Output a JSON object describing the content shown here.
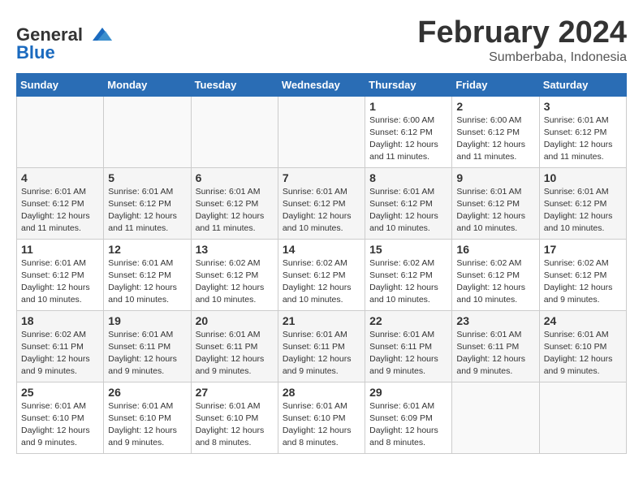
{
  "logo": {
    "general": "General",
    "blue": "Blue"
  },
  "title": "February 2024",
  "subtitle": "Sumberbaba, Indonesia",
  "headers": [
    "Sunday",
    "Monday",
    "Tuesday",
    "Wednesday",
    "Thursday",
    "Friday",
    "Saturday"
  ],
  "weeks": [
    [
      {
        "day": "",
        "info": ""
      },
      {
        "day": "",
        "info": ""
      },
      {
        "day": "",
        "info": ""
      },
      {
        "day": "",
        "info": ""
      },
      {
        "day": "1",
        "info": "Sunrise: 6:00 AM\nSunset: 6:12 PM\nDaylight: 12 hours\nand 11 minutes."
      },
      {
        "day": "2",
        "info": "Sunrise: 6:00 AM\nSunset: 6:12 PM\nDaylight: 12 hours\nand 11 minutes."
      },
      {
        "day": "3",
        "info": "Sunrise: 6:01 AM\nSunset: 6:12 PM\nDaylight: 12 hours\nand 11 minutes."
      }
    ],
    [
      {
        "day": "4",
        "info": "Sunrise: 6:01 AM\nSunset: 6:12 PM\nDaylight: 12 hours\nand 11 minutes."
      },
      {
        "day": "5",
        "info": "Sunrise: 6:01 AM\nSunset: 6:12 PM\nDaylight: 12 hours\nand 11 minutes."
      },
      {
        "day": "6",
        "info": "Sunrise: 6:01 AM\nSunset: 6:12 PM\nDaylight: 12 hours\nand 11 minutes."
      },
      {
        "day": "7",
        "info": "Sunrise: 6:01 AM\nSunset: 6:12 PM\nDaylight: 12 hours\nand 10 minutes."
      },
      {
        "day": "8",
        "info": "Sunrise: 6:01 AM\nSunset: 6:12 PM\nDaylight: 12 hours\nand 10 minutes."
      },
      {
        "day": "9",
        "info": "Sunrise: 6:01 AM\nSunset: 6:12 PM\nDaylight: 12 hours\nand 10 minutes."
      },
      {
        "day": "10",
        "info": "Sunrise: 6:01 AM\nSunset: 6:12 PM\nDaylight: 12 hours\nand 10 minutes."
      }
    ],
    [
      {
        "day": "11",
        "info": "Sunrise: 6:01 AM\nSunset: 6:12 PM\nDaylight: 12 hours\nand 10 minutes."
      },
      {
        "day": "12",
        "info": "Sunrise: 6:01 AM\nSunset: 6:12 PM\nDaylight: 12 hours\nand 10 minutes."
      },
      {
        "day": "13",
        "info": "Sunrise: 6:02 AM\nSunset: 6:12 PM\nDaylight: 12 hours\nand 10 minutes."
      },
      {
        "day": "14",
        "info": "Sunrise: 6:02 AM\nSunset: 6:12 PM\nDaylight: 12 hours\nand 10 minutes."
      },
      {
        "day": "15",
        "info": "Sunrise: 6:02 AM\nSunset: 6:12 PM\nDaylight: 12 hours\nand 10 minutes."
      },
      {
        "day": "16",
        "info": "Sunrise: 6:02 AM\nSunset: 6:12 PM\nDaylight: 12 hours\nand 10 minutes."
      },
      {
        "day": "17",
        "info": "Sunrise: 6:02 AM\nSunset: 6:12 PM\nDaylight: 12 hours\nand 9 minutes."
      }
    ],
    [
      {
        "day": "18",
        "info": "Sunrise: 6:02 AM\nSunset: 6:11 PM\nDaylight: 12 hours\nand 9 minutes."
      },
      {
        "day": "19",
        "info": "Sunrise: 6:01 AM\nSunset: 6:11 PM\nDaylight: 12 hours\nand 9 minutes."
      },
      {
        "day": "20",
        "info": "Sunrise: 6:01 AM\nSunset: 6:11 PM\nDaylight: 12 hours\nand 9 minutes."
      },
      {
        "day": "21",
        "info": "Sunrise: 6:01 AM\nSunset: 6:11 PM\nDaylight: 12 hours\nand 9 minutes."
      },
      {
        "day": "22",
        "info": "Sunrise: 6:01 AM\nSunset: 6:11 PM\nDaylight: 12 hours\nand 9 minutes."
      },
      {
        "day": "23",
        "info": "Sunrise: 6:01 AM\nSunset: 6:11 PM\nDaylight: 12 hours\nand 9 minutes."
      },
      {
        "day": "24",
        "info": "Sunrise: 6:01 AM\nSunset: 6:10 PM\nDaylight: 12 hours\nand 9 minutes."
      }
    ],
    [
      {
        "day": "25",
        "info": "Sunrise: 6:01 AM\nSunset: 6:10 PM\nDaylight: 12 hours\nand 9 minutes."
      },
      {
        "day": "26",
        "info": "Sunrise: 6:01 AM\nSunset: 6:10 PM\nDaylight: 12 hours\nand 9 minutes."
      },
      {
        "day": "27",
        "info": "Sunrise: 6:01 AM\nSunset: 6:10 PM\nDaylight: 12 hours\nand 8 minutes."
      },
      {
        "day": "28",
        "info": "Sunrise: 6:01 AM\nSunset: 6:10 PM\nDaylight: 12 hours\nand 8 minutes."
      },
      {
        "day": "29",
        "info": "Sunrise: 6:01 AM\nSunset: 6:09 PM\nDaylight: 12 hours\nand 8 minutes."
      },
      {
        "day": "",
        "info": ""
      },
      {
        "day": "",
        "info": ""
      }
    ]
  ]
}
